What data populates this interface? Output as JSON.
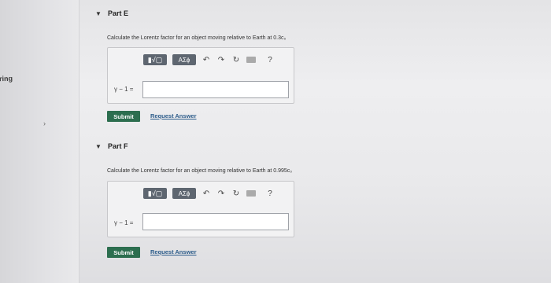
{
  "sidebar": {
    "label": "ring",
    "arrow": "›"
  },
  "parts": [
    {
      "title": "Part E",
      "question": "Calculate the Lorentz factor for an object moving relative to Earth at 0.3c₀",
      "toolbar": {
        "template": "▮√▢",
        "symbol": "ΑΣϕ",
        "undo": "↶",
        "redo": "↷",
        "reset": "↻",
        "keyboard": "⌨",
        "help": "?"
      },
      "equation_label": "γ − 1 =",
      "input_value": "",
      "submit_label": "Submit",
      "request_label": "Request Answer"
    },
    {
      "title": "Part F",
      "question": "Calculate the Lorentz factor for an object moving relative to Earth at 0.995c₀",
      "toolbar": {
        "template": "▮√▢",
        "symbol": "ΑΣϕ",
        "undo": "↶",
        "redo": "↷",
        "reset": "↻",
        "keyboard": "⌨",
        "help": "?"
      },
      "equation_label": "γ − 1 =",
      "input_value": "",
      "submit_label": "Submit",
      "request_label": "Request Answer"
    }
  ]
}
